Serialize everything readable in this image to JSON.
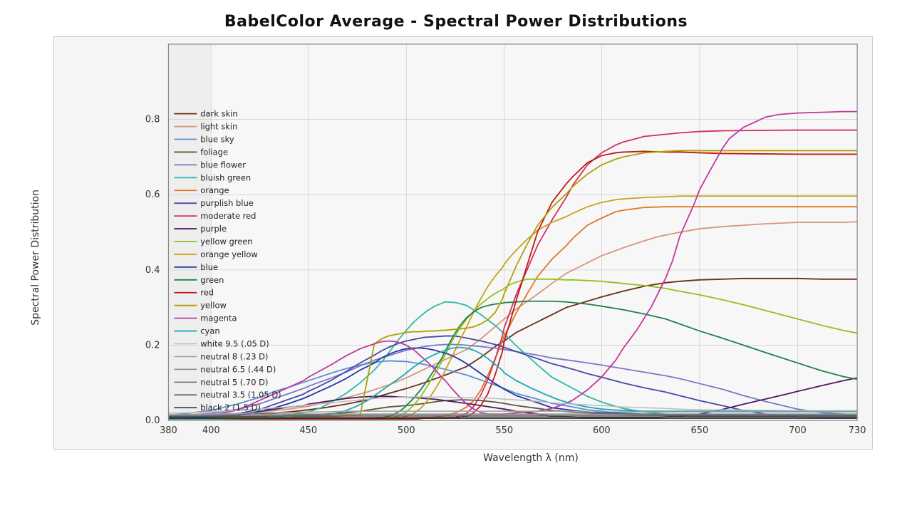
{
  "title": "BabelColor Average - Spectral Power Distributions",
  "yAxisLabel": "Spectral Power Distribution",
  "xAxisLabel": "Wavelength λ (nm)",
  "legend": [
    {
      "label": "dark skin",
      "color": "#6B2C1A"
    },
    {
      "label": "light skin",
      "color": "#C9967A"
    },
    {
      "label": "blue sky",
      "color": "#5B7DB1"
    },
    {
      "label": "foliage",
      "color": "#4A4A3A"
    },
    {
      "label": "blue flower",
      "color": "#7B7BC8"
    },
    {
      "label": "bluish green",
      "color": "#3BBCB0"
    },
    {
      "label": "orange",
      "color": "#E07830"
    },
    {
      "label": "purplish blue",
      "color": "#4A4AAA"
    },
    {
      "label": "moderate red",
      "color": "#D04060"
    },
    {
      "label": "purple",
      "color": "#4A2060"
    },
    {
      "label": "yellow green",
      "color": "#A0C030"
    },
    {
      "label": "orange yellow",
      "color": "#D0A020"
    },
    {
      "label": "blue",
      "color": "#2040A0"
    },
    {
      "label": "green",
      "color": "#208050"
    },
    {
      "label": "red",
      "color": "#C02020"
    },
    {
      "label": "yellow",
      "color": "#C0B000"
    },
    {
      "label": "magenta",
      "color": "#C040A0"
    },
    {
      "label": "cyan",
      "color": "#20A0B0"
    },
    {
      "label": "white 9.5 (.05 D)",
      "color": "#C0C0C0"
    },
    {
      "label": "neutral 8 (.23 D)",
      "color": "#A0A0A0"
    },
    {
      "label": "neutral 6.5 (.44 D)",
      "color": "#888888"
    },
    {
      "label": "neutral 5 (.70 D)",
      "color": "#686868"
    },
    {
      "label": "neutral 3.5 (1.05 D)",
      "color": "#484848"
    },
    {
      "label": "black 2 (1.5 D)",
      "color": "#282828"
    }
  ],
  "xTicks": [
    "380",
    "400",
    "450",
    "500",
    "550",
    "600",
    "650",
    "700",
    "730"
  ],
  "yTicks": [
    "0.0",
    "0.2",
    "0.4",
    "0.6",
    "0.8"
  ]
}
